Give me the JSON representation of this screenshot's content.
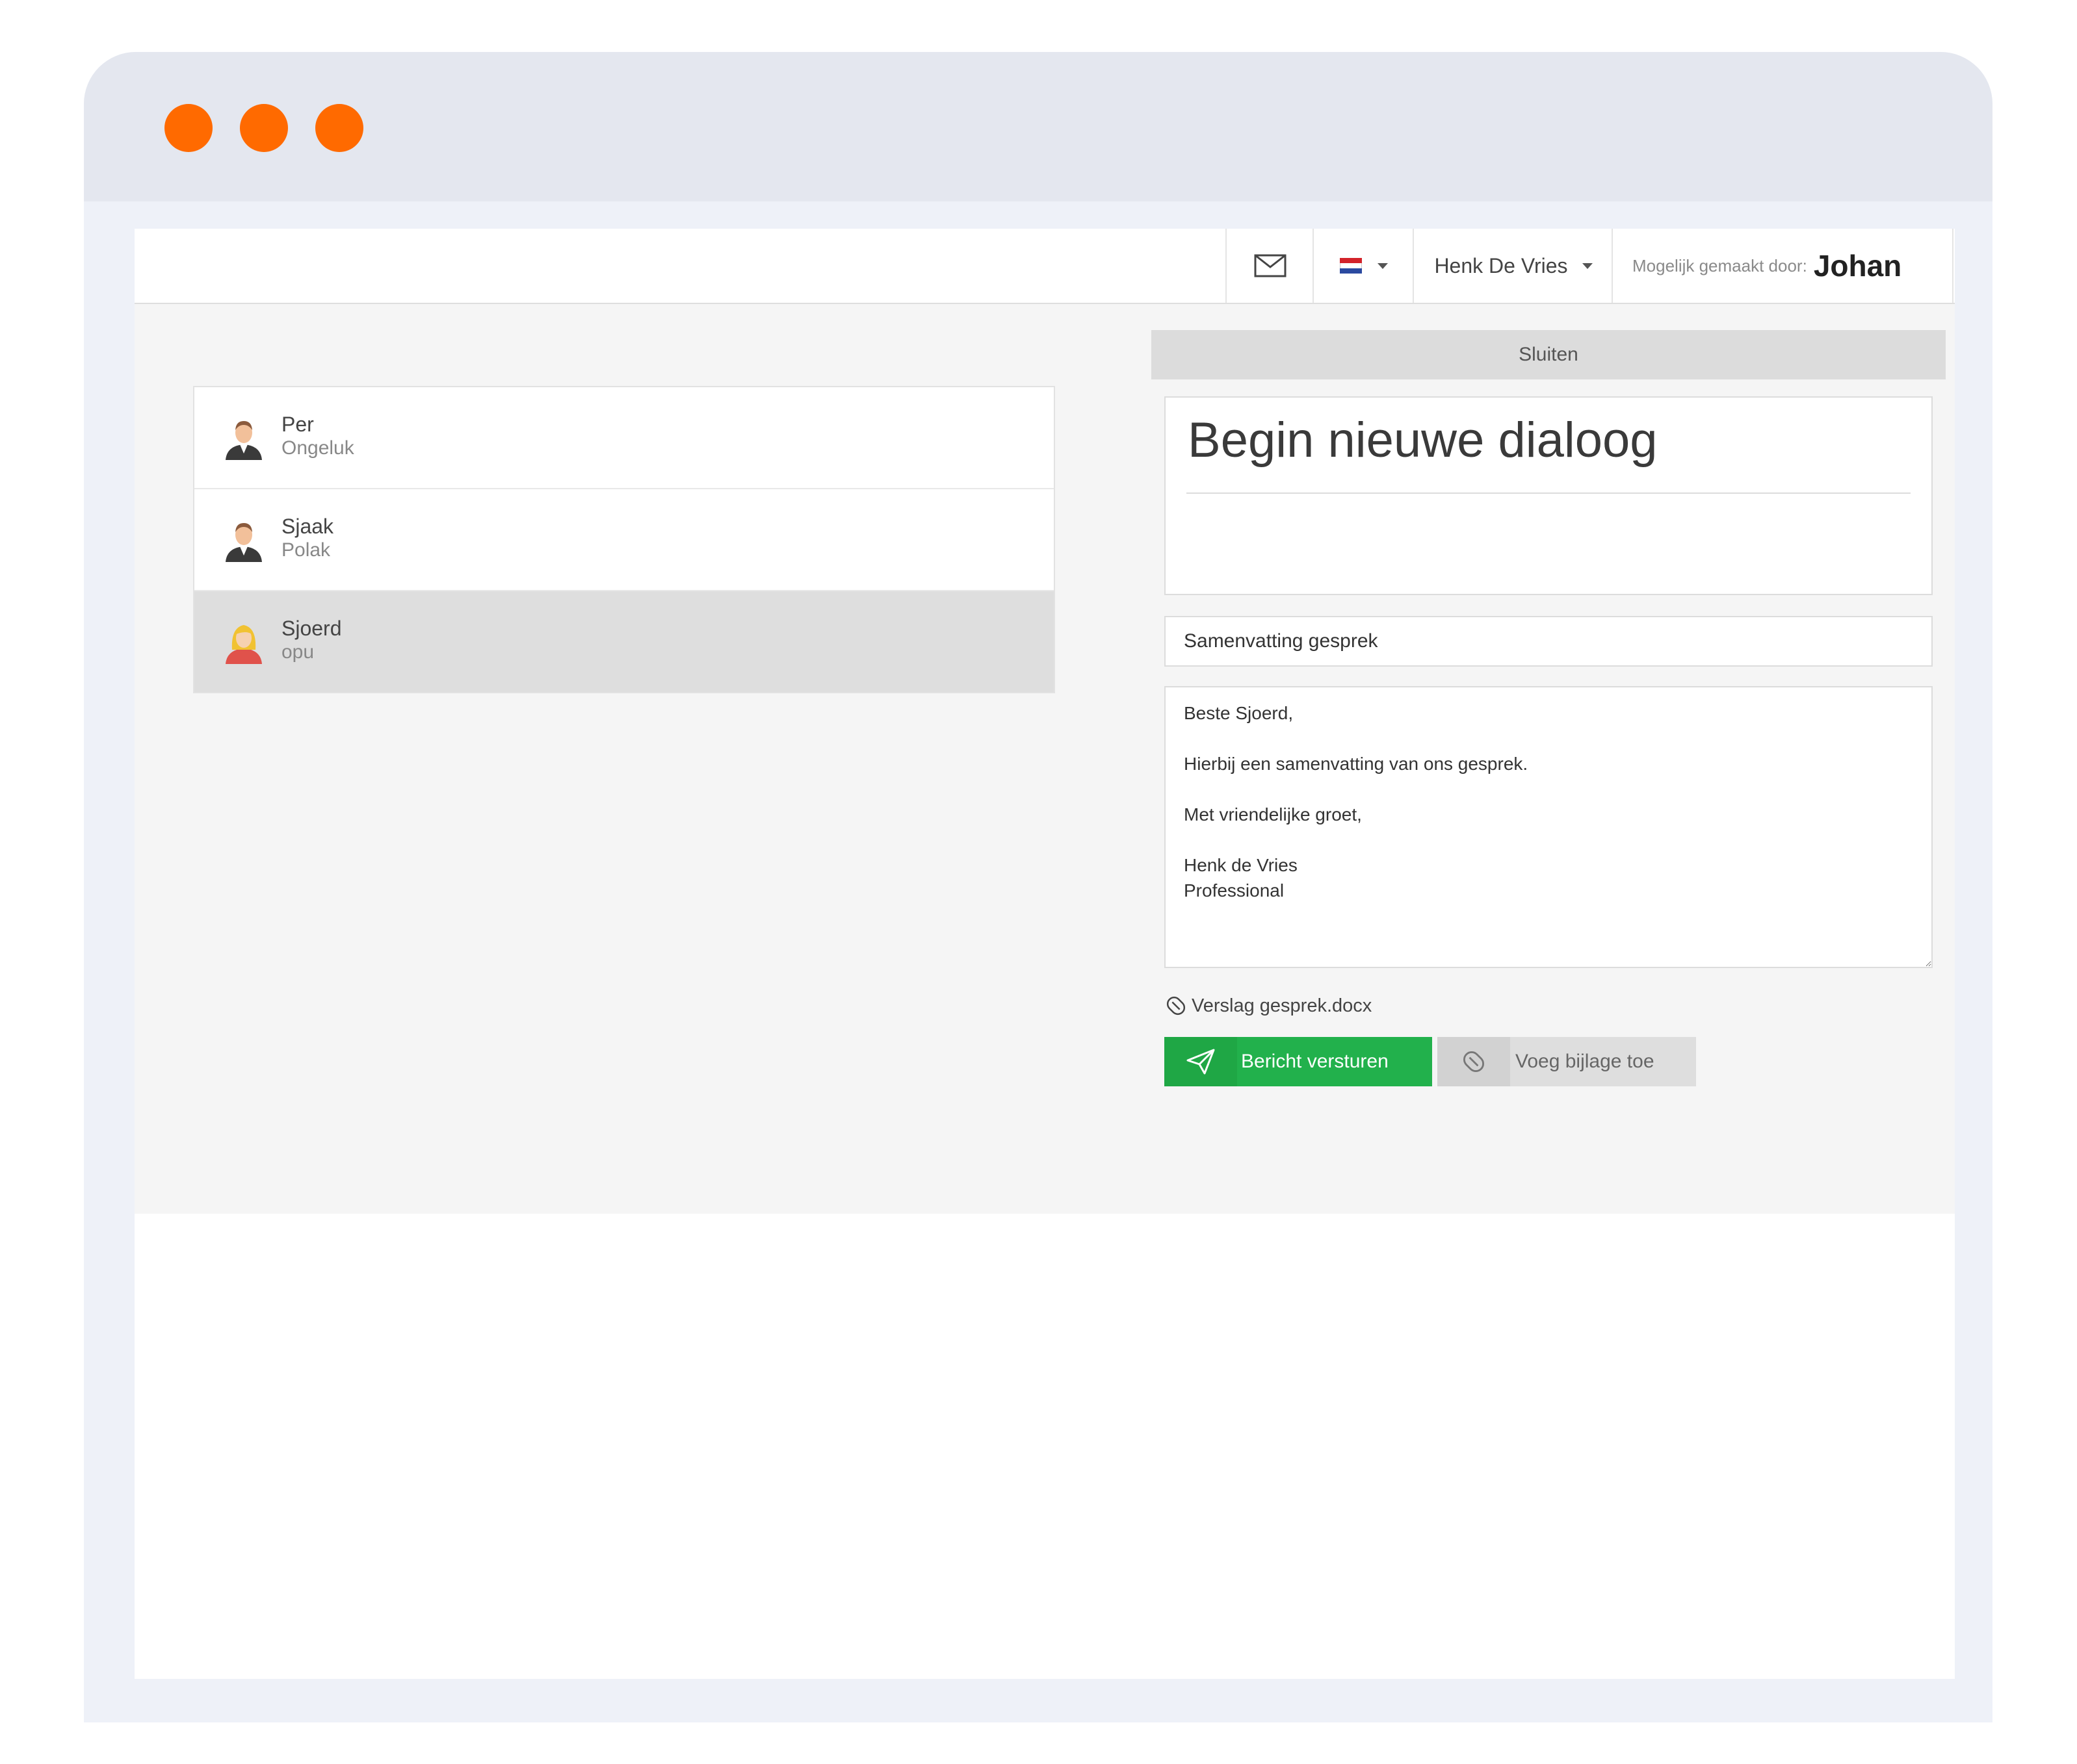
{
  "window": {
    "traffic_lights": [
      "close",
      "minimize",
      "maximize"
    ],
    "accent_color": "#ff6a00"
  },
  "topbar": {
    "mail_icon": "mail-icon",
    "language_flag": "dutch-flag",
    "user_name": "Henk De Vries",
    "made_by_label": "Mogelijk gemaakt door:",
    "made_by_name": "Johan"
  },
  "contacts": [
    {
      "name": "Per",
      "subtitle": "Ongeluk",
      "avatar": "male-avatar",
      "selected": false
    },
    {
      "name": "Sjaak",
      "subtitle": "Polak",
      "avatar": "male-avatar",
      "selected": false
    },
    {
      "name": "Sjoerd",
      "subtitle": "opu",
      "avatar": "female-avatar",
      "selected": true
    }
  ],
  "panel": {
    "close_label": "Sluiten",
    "title": "Begin nieuwe dialoog",
    "subject_value": "Samenvatting gesprek",
    "message_value": "Beste Sjoerd,\n\nHierbij een samenvatting van ons gesprek.\n\nMet vriendelijke groet,\n\nHenk de Vries\nProfessional",
    "attachment_name": "Verslag gesprek.docx",
    "send_label": "Bericht versturen",
    "attach_label": "Voeg bijlage toe",
    "send_color": "#22b14c"
  }
}
